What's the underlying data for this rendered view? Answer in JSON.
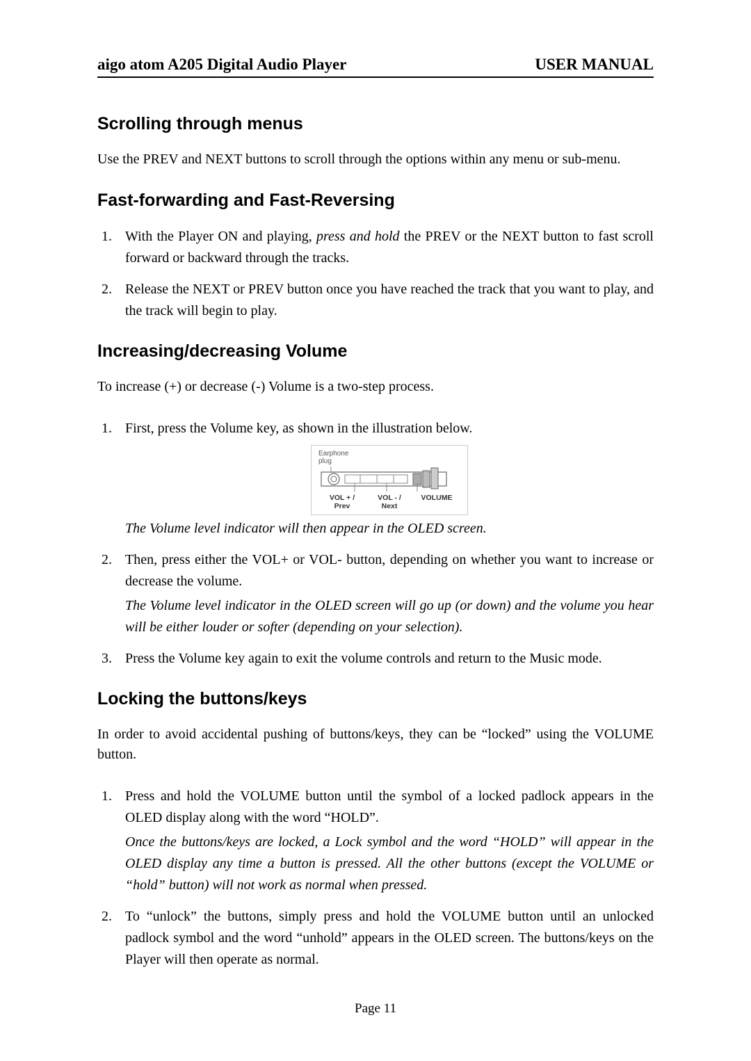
{
  "header": {
    "left": "aigo atom A205 Digital Audio Player",
    "right": "USER MANUAL"
  },
  "sections": {
    "scroll": {
      "title": "Scrolling through menus",
      "body": "Use the PREV and NEXT buttons to scroll through the options within any menu or sub-menu."
    },
    "fastfwd": {
      "title": "Fast-forwarding and Fast-Reversing",
      "item1_pre": "With the Player ON and playing, ",
      "item1_em": "press and hold",
      "item1_post": " the PREV or the NEXT button to fast scroll forward or backward through the tracks.",
      "item2": "Release the NEXT or PREV button once you have reached the track that you want to play, and the track will begin to play."
    },
    "volume": {
      "title": "Increasing/decreasing Volume",
      "body": "To increase (+) or decrease (-) Volume is a two-step process.",
      "item1": "First, press the Volume key, as shown in the illustration below.",
      "caption1": "The Volume level indicator will then appear in the OLED screen.",
      "item2_body": "Then, press either the VOL+ or VOL- button, depending on whether you want to increase or decrease the volume.",
      "item2_em": "The Volume level indicator in the OLED screen will go up (or down) and the volume you hear will be either louder or softer (depending on your selection).",
      "item3": "Press the Volume key again to exit the volume controls and return to the Music mode."
    },
    "lock": {
      "title": "Locking the buttons/keys",
      "body": "In order to avoid accidental pushing of buttons/keys, they can be “locked” using the VOLUME button.",
      "item1_body": "Press and hold the VOLUME button until the symbol of a locked padlock appears in the OLED display along with the word “HOLD”.",
      "item1_em": "Once the buttons/keys are locked, a Lock symbol and the word “HOLD” will appear in the OLED display any time a button is pressed.   All the other buttons (except the VOLUME or “hold” button) will not work as normal when pressed.",
      "item2": "To “unlock” the buttons, simply press and hold the VOLUME button until an unlocked padlock symbol and the word “unhold” appears in the OLED screen.   The buttons/keys on the Player will then operate as normal."
    }
  },
  "illustration": {
    "earphone_label": "Earphone",
    "plug_label": "plug",
    "volplus_line1": "VOL + /",
    "volplus_line2": "Prev",
    "volminus_line1": "VOL - /",
    "volminus_line2": "Next",
    "volume_label": "VOLUME"
  },
  "footer": {
    "page": "Page 11"
  }
}
